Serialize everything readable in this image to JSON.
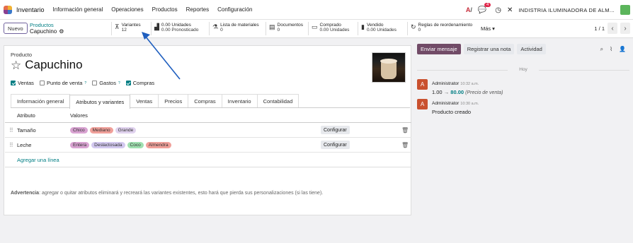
{
  "topbar": {
    "app_name": "Inventario",
    "menu": [
      "Información general",
      "Operaciones",
      "Productos",
      "Reportes",
      "Configuración"
    ],
    "notif_count": "4",
    "company": "INDISTRIA ILUMINADORA DE ALM..."
  },
  "controls": {
    "new_label": "Nuevo",
    "breadcrumb_parent": "Productos",
    "breadcrumb_current": "Capuchino",
    "smart_buttons": [
      {
        "icon": "sitemap-icon",
        "line1": "Variantes",
        "line2": "12"
      },
      {
        "icon": "chart-icon",
        "line1": "0.00 Unidades",
        "line2": "0.00 Pronosticado"
      },
      {
        "icon": "flask-icon",
        "line1": "Lista de materiales",
        "line2": "0"
      },
      {
        "icon": "file-icon",
        "line1": "Documentos",
        "line2": "0"
      },
      {
        "icon": "credit-card-icon",
        "line1": "Comprado",
        "line2": "0.00 Unidades"
      },
      {
        "icon": "bar-chart-icon",
        "line1": "Vendido",
        "line2": "0.00 Unidades"
      },
      {
        "icon": "refresh-icon",
        "line1": "Reglas de reordenamiento",
        "line2": "0"
      }
    ],
    "more_label": "Más",
    "pager": "1 / 1"
  },
  "form": {
    "product_label": "Producto",
    "product_name": "Capuchino",
    "checks": [
      {
        "label": "Ventas",
        "checked": true,
        "help": ""
      },
      {
        "label": "Punto de venta",
        "checked": false,
        "help": "?"
      },
      {
        "label": "Gastos",
        "checked": false,
        "help": "?"
      },
      {
        "label": "Compras",
        "checked": true,
        "help": ""
      }
    ],
    "tabs": [
      "Información general",
      "Atributos y variantes",
      "Ventas",
      "Precios",
      "Compras",
      "Inventario",
      "Contabilidad"
    ],
    "active_tab": 1,
    "table_headers": [
      "Atributo",
      "Valores"
    ],
    "rows": [
      {
        "attribute": "Tamaño",
        "values": [
          {
            "label": "Chico",
            "color": "#d9a3d2"
          },
          {
            "label": "Mediano",
            "color": "#f0a09a"
          },
          {
            "label": "Grande",
            "color": "#e0d2ee"
          }
        ]
      },
      {
        "attribute": "Leche",
        "values": [
          {
            "label": "Entera",
            "color": "#d9a3d2"
          },
          {
            "label": "Deslactosada",
            "color": "#d2c8ef"
          },
          {
            "label": "Coco",
            "color": "#9fe0b0"
          },
          {
            "label": "Almendra",
            "color": "#f0a09a"
          }
        ]
      }
    ],
    "configure_label": "Configurar",
    "add_line": "Agregar una línea",
    "warning_bold": "Advertencia",
    "warning_text": ": agregar o quitar atributos eliminará y recreará las variantes existentes, esto hará que pierda sus personalizaciones (si las tiene)."
  },
  "chatter": {
    "send_message": "Enviar mensaje",
    "log_note": "Registrar una nota",
    "activity": "Actividad",
    "day_separator": "Hoy",
    "messages": [
      {
        "avatar": "A",
        "author": "Administrator",
        "time": "10:32 a.m.",
        "old": "1.00",
        "arrow": "→",
        "new": "80.00",
        "field": "(Precio de venta)"
      },
      {
        "avatar": "A",
        "author": "Administrator",
        "time": "10:30 a.m.",
        "body": "Producto creado"
      }
    ]
  },
  "colors": {
    "accent": "#017e84",
    "brand": "#714b67",
    "arrow": "#1f5fbf"
  }
}
